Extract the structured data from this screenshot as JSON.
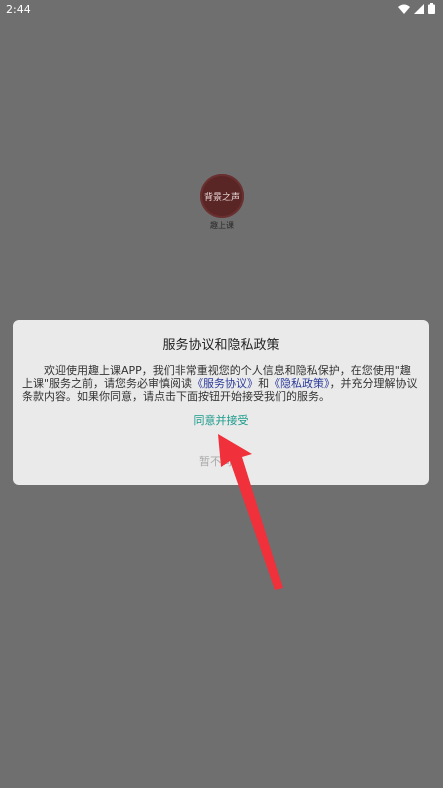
{
  "status_bar": {
    "time": "2:44",
    "icons": [
      "wifi-icon",
      "signal-icon",
      "battery-icon"
    ]
  },
  "app": {
    "logo_text": "背景之声",
    "name": "趣上课"
  },
  "dialog": {
    "title": "服务协议和隐私政策",
    "body_part1": "欢迎使用趣上课APP，我们非常重视您的个人信息和隐私保护，在您使用\"趣上课\"服务之前，请您务必审慎阅读",
    "service_link": "《服务协议》",
    "body_and": "和",
    "privacy_link": "《隐私政策》",
    "body_part2": "，并充分理解协议条款内容。如果你同意，请点击下面按钮开始接受我们的服务。",
    "accept_label": "同意并接受",
    "decline_label": "暂不同意"
  },
  "colors": {
    "overlay": "#6f6f6f",
    "dialog_bg": "#eaeaea",
    "accept_text": "#1a9a8a",
    "link_text": "#2a3a9a",
    "arrow": "#f0303a"
  }
}
